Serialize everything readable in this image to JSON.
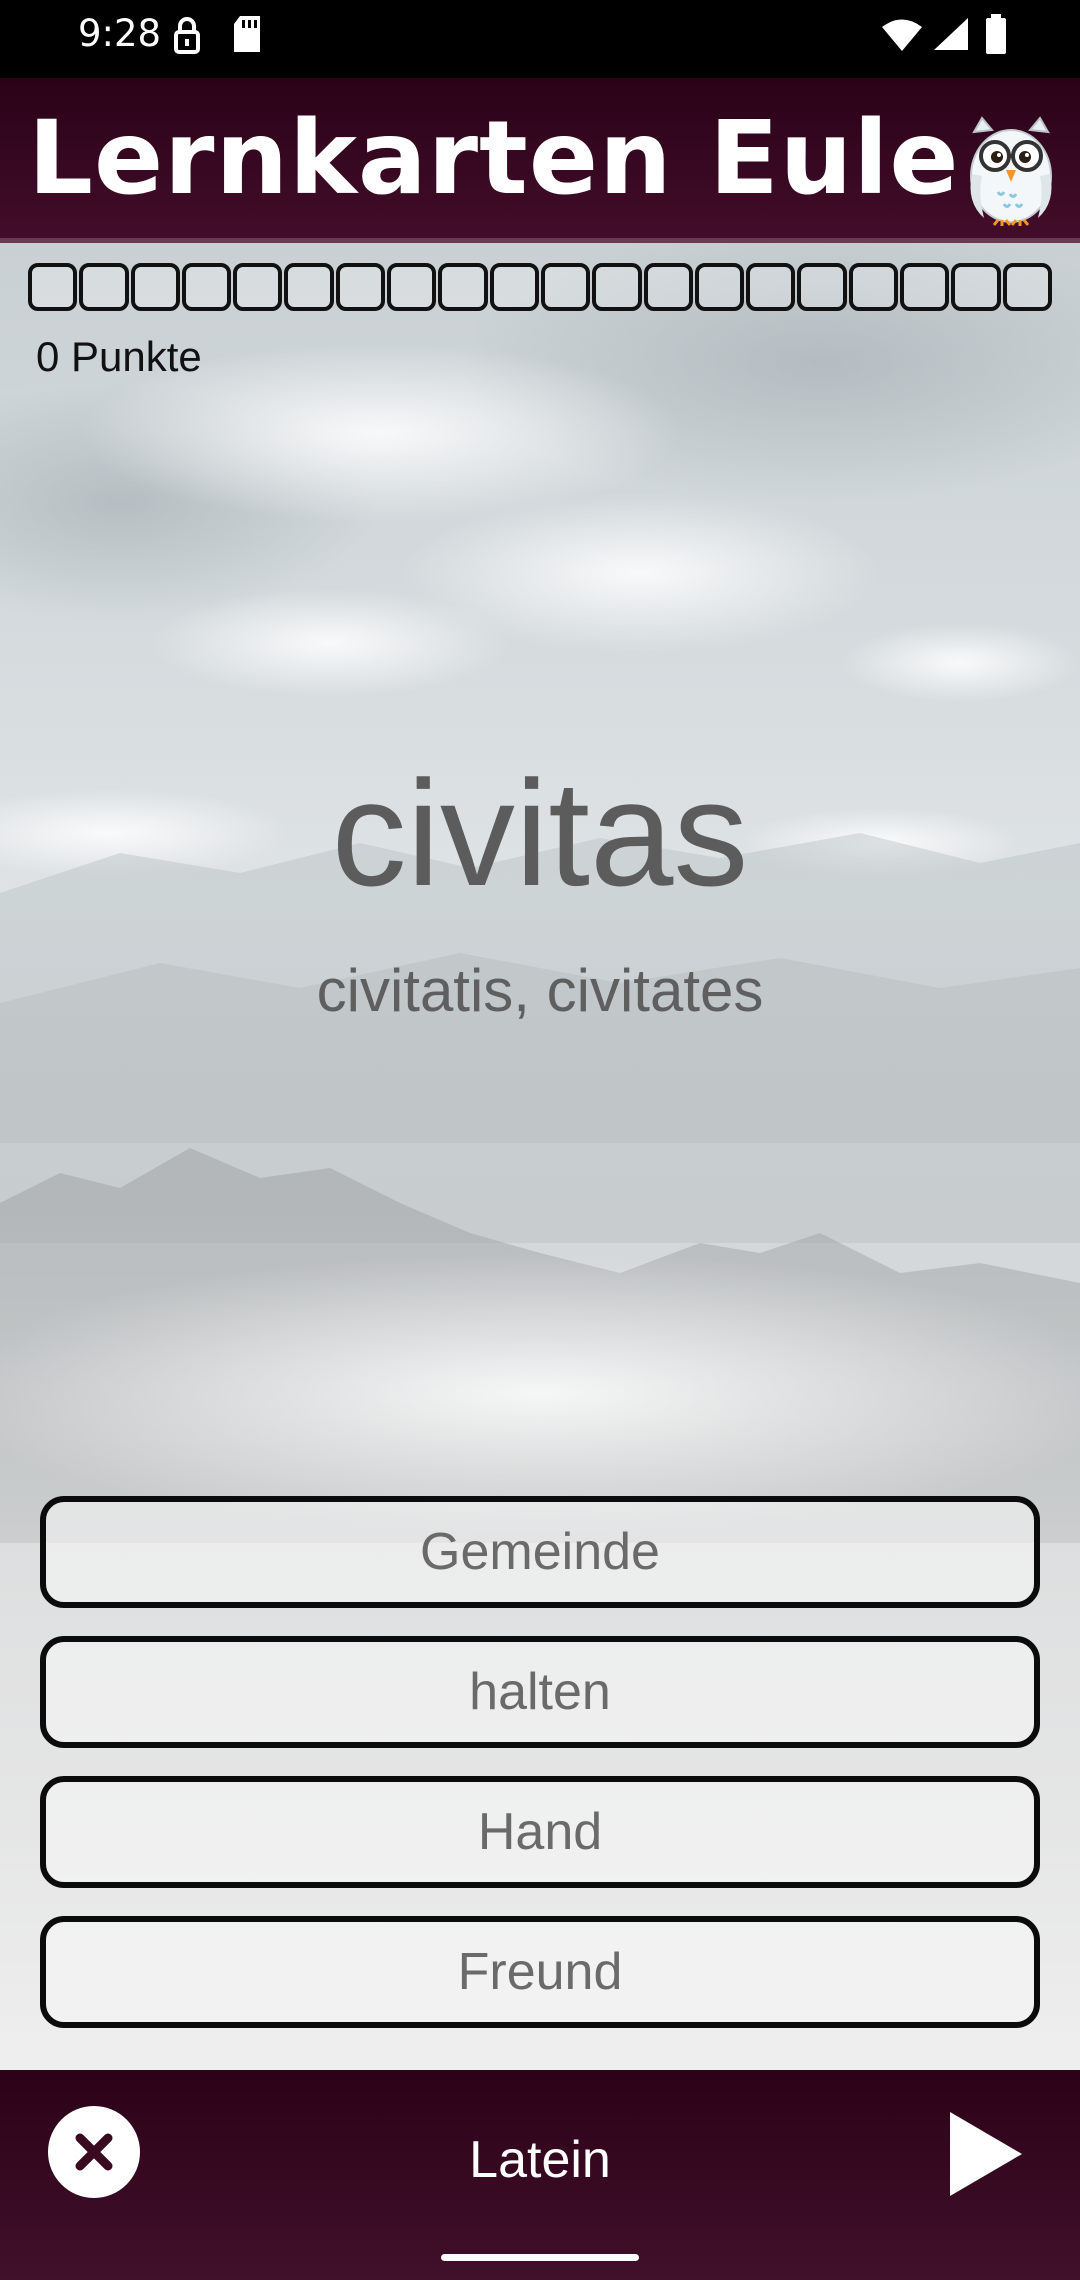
{
  "status_bar": {
    "time": "9:28",
    "icons": [
      "vpn-key-icon",
      "sd-card-icon",
      "wifi-icon",
      "cell-signal-icon",
      "battery-icon"
    ]
  },
  "app_bar": {
    "title": "Lernkarten Eule",
    "logo_icon": "owl-logo",
    "background": "#2a0217"
  },
  "quiz": {
    "progress_cells": 20,
    "score_text": "0 Punkte",
    "word": "civitas",
    "word_forms": "civitatis, civitates",
    "answers": [
      {
        "label": "Gemeinde"
      },
      {
        "label": "halten"
      },
      {
        "label": "Hand"
      },
      {
        "label": "Freund"
      }
    ]
  },
  "bottom_bar": {
    "close_icon": "close-icon",
    "language": "Latein",
    "next_icon": "play-icon",
    "background": "#2c0218"
  }
}
